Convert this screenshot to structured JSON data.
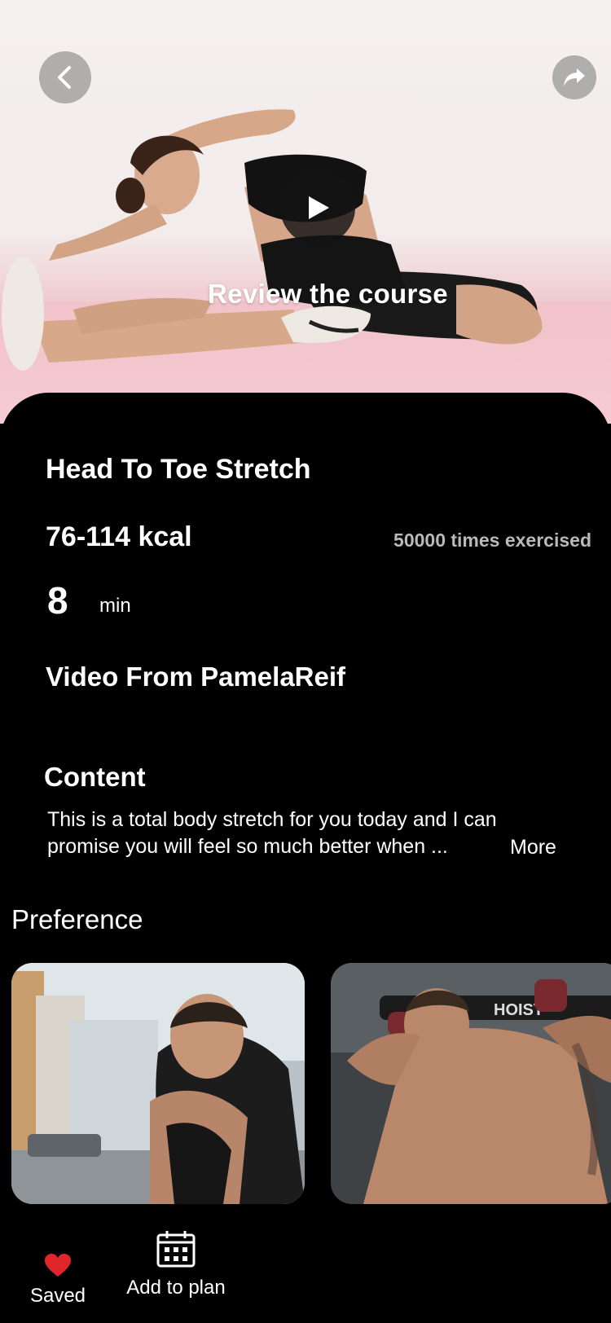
{
  "hero": {
    "review_label": "Review the course",
    "icons": {
      "back": "chevron-left-icon",
      "share": "share-arrow-icon",
      "play": "play-icon"
    }
  },
  "workout": {
    "title": "Head To Toe Stretch",
    "kcal": "76-114 kcal",
    "times_exercised": "50000 times exercised",
    "duration_value": "8",
    "duration_unit": "min",
    "video_from": "Video From PamelaReif"
  },
  "content": {
    "heading": "Content",
    "description": "This is a total body stretch for you today and I can promise you will feel so much better when ...",
    "more_label": "More"
  },
  "preference": {
    "heading": "Preference"
  },
  "bottom_bar": {
    "saved_label": "Saved",
    "add_to_plan_label": "Add to plan",
    "colors": {
      "heart": "#e1262b"
    }
  }
}
